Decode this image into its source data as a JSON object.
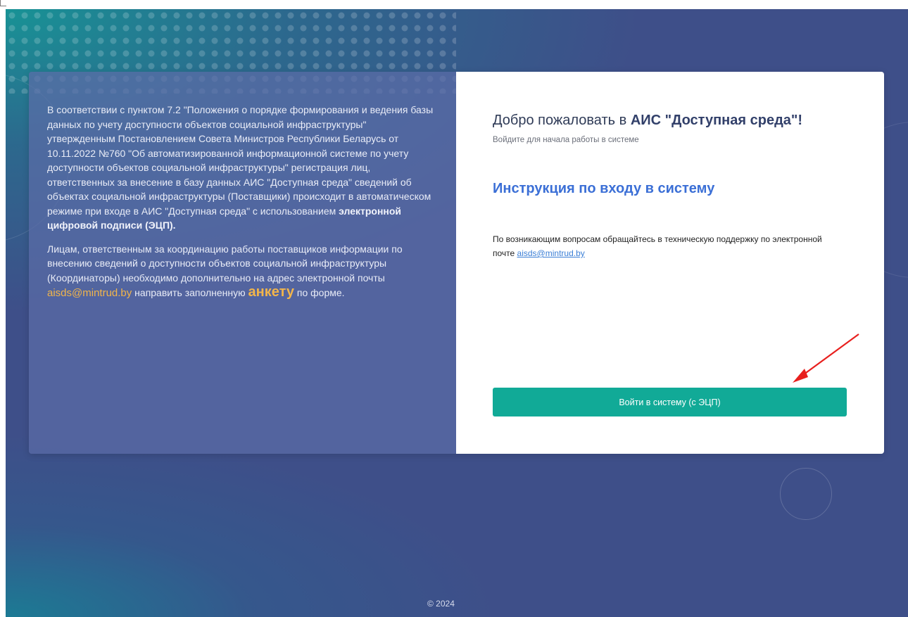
{
  "info": {
    "paragraph1_text": "В соответствии с пунктом 7.2 \"Положения о порядке формирования и ведения базы данных по учету доступности объектов социальной инфраструктуры\" утвержденным Постановлением Совета Министров Республики Беларусь от 10.11.2022 №760 \"Об автоматизированной информационной системе по учету доступности объектов социальной инфраструктуры\" регистрация лиц, ответственных за внесение в базу данных АИС \"Доступная среда\" сведений об объектах социальной инфраструктуры (Поставщики) происходит в автоматическом режиме при входе в АИС \"Доступная среда\" с использованием ",
    "paragraph1_bold": "электронной цифровой подписи (ЭЦП).",
    "paragraph2_text": "Лицам, ответственным за координацию работы поставщиков информации по внесению сведений о доступности объектов социальной инфраструктуры (Координаторы) необходимо дополнительно на адрес электронной почты ",
    "paragraph2_email": "aisds@mintrud.by",
    "paragraph2_after_email": " направить заполненную ",
    "paragraph2_anketa": "анкету",
    "paragraph2_end": " по форме."
  },
  "login": {
    "welcome_prefix": "Добро пожаловать в ",
    "welcome_brand": "АИС \"Доступная среда\"",
    "welcome_suffix": "!",
    "subtitle": "Войдите для начала работы в системе",
    "instruction_link": "Инструкция по входу в систему",
    "support_text": "По возникающим вопросам обращайтесь в техническую поддержку по электронной почте ",
    "support_email": "aisds@mintrud.by",
    "button_label": "Войти в систему (с ЭЦП)"
  },
  "footer": {
    "copyright": "© 2024"
  },
  "colors": {
    "accent_button": "#11aa97",
    "link_blue": "#3b6fd6",
    "highlight_orange": "#f2b54b",
    "annotation_arrow": "#e8201e"
  }
}
